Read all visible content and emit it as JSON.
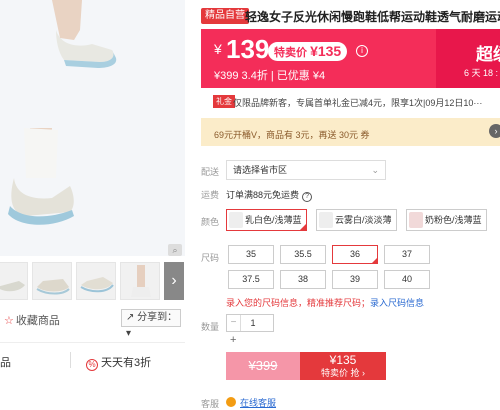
{
  "product": {
    "badge": "精品自营",
    "title": "轻逸女子反光休闲慢跑鞋低帮运动鞋透气耐磨运动鞋"
  },
  "price": {
    "currency": "¥",
    "current": "139",
    "special_label": "特卖价",
    "special_price": "¥135",
    "info_icon": "info-icon",
    "sub_line": "¥399 3.4折 | 已优惠 ¥4",
    "super_label": "超级",
    "countdown": "6 天 18 :"
  },
  "promo": {
    "badge": "礼金",
    "text": "仅限品牌新客，专属首单礼金已减4元，限享1次|09月12日10···"
  },
  "coupon": {
    "text": "69元开桶V，商品有 3元，再送 30元 券",
    "go_icon": "chevron-right-icon"
  },
  "labels": {
    "delivery": "配送",
    "freight": "运费",
    "color": "颜色",
    "size": "尺码",
    "quantity": "数量",
    "service": "客服"
  },
  "delivery": {
    "placeholder": "请选择省市区",
    "freight_text": "订单满88元免运费"
  },
  "colors": [
    {
      "label": "乳白色/浅薄蓝",
      "selected": true
    },
    {
      "label": "云雾白/淡淡薄",
      "selected": false
    },
    {
      "label": "奶粉色/浅薄蓝",
      "selected": false
    }
  ],
  "sizes": [
    {
      "label": "35",
      "selected": false
    },
    {
      "label": "35.5",
      "selected": false
    },
    {
      "label": "36",
      "selected": true
    },
    {
      "label": "37",
      "selected": false
    },
    {
      "label": "37.5",
      "selected": false
    },
    {
      "label": "38",
      "selected": false
    },
    {
      "label": "39",
      "selected": false
    },
    {
      "label": "40",
      "selected": false
    }
  ],
  "size_note": {
    "text": "录入您的尺码信息，精准推荐尺码；",
    "link": "录入尺码信息"
  },
  "quantity": {
    "minus": "−",
    "value": "1",
    "plus": "+"
  },
  "buy": {
    "original": "¥399",
    "special_price": "¥135",
    "special_action": "特卖价 抢 ›"
  },
  "service_link": "在线客服",
  "left": {
    "favorite": "收藏商品",
    "share": "分享到：",
    "fragment": "品",
    "daily": "天天有3折",
    "next_icon": "chevron-right-icon"
  },
  "colors_palette": {
    "banner": "#f42d59",
    "red": "#e4393c",
    "coupon_bg": "#fbecc9"
  }
}
